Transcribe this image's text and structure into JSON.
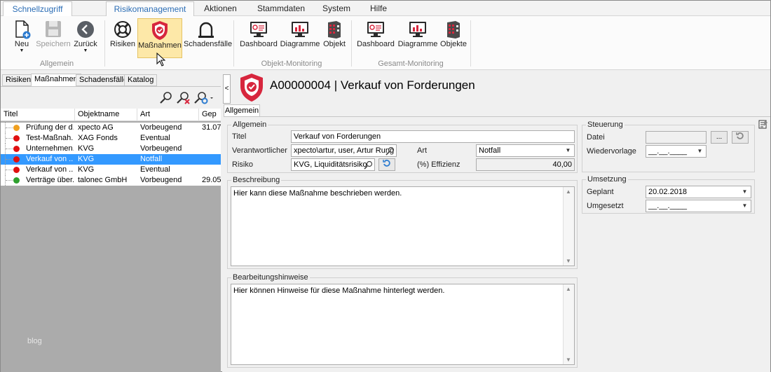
{
  "ribbon": {
    "tabs": [
      "Schnellzugriff",
      "Risikomanagement",
      "Aktionen",
      "Stammdaten",
      "System",
      "Hilfe"
    ],
    "active_tab": "Risikomanagement",
    "buttons": {
      "neu": "Neu",
      "speichern": "Speichern",
      "zurueck": "Zurück",
      "risiken": "Risiken",
      "massnahmen": "Maßnahmen",
      "schadensfaelle": "Schadensfälle",
      "dashboard1": "Dashboard",
      "diagramme1": "Diagramme",
      "objekt": "Objekt",
      "dashboard2": "Dashboard",
      "diagramme2": "Diagramme",
      "objekte": "Objekte"
    },
    "groups": {
      "allgemein": "Allgemein",
      "objekt_monitoring": "Objekt-Monitoring",
      "gesamt_monitoring": "Gesamt-Monitoring"
    },
    "accent": "#d7263d"
  },
  "left": {
    "tabs": [
      "Risiken",
      "Maßnahmen",
      "Schadensfälle",
      "Katalog"
    ],
    "active_tab": "Maßnahmen",
    "columns": [
      "Titel",
      "Objektname",
      "Art",
      "Gep"
    ],
    "rows": [
      {
        "titel": "Prüfung der d...",
        "objekt": "xpecto AG",
        "art": "Vorbeugend",
        "gep": "31.07",
        "status": "#f0a020",
        "selected": false
      },
      {
        "titel": "Test-Maßnah...",
        "objekt": "XAG Fonds",
        "art": "Eventual",
        "gep": "",
        "status": "#e01010",
        "selected": false
      },
      {
        "titel": "Unternehmen...",
        "objekt": "KVG",
        "art": "Vorbeugend",
        "gep": "",
        "status": "#e01010",
        "selected": false
      },
      {
        "titel": "Verkauf von ...",
        "objekt": "KVG",
        "art": "Notfall",
        "gep": "",
        "status": "#e01010",
        "selected": true
      },
      {
        "titel": "Verkauf von ...",
        "objekt": "KVG",
        "art": "Eventual",
        "gep": "",
        "status": "#e01010",
        "selected": false
      },
      {
        "titel": "Verträge über...",
        "objekt": "talonec GmbH",
        "art": "Vorbeugend",
        "gep": "29.05",
        "status": "#2ea02e",
        "selected": false
      }
    ],
    "watermark": "blog"
  },
  "detail": {
    "title": "A00000004 | Verkauf von Forderungen",
    "tab": "Allgemein",
    "allgemein": {
      "legend": "Allgemein",
      "titel_label": "Titel",
      "titel_value": "Verkauf von Forderungen",
      "verantwortlicher_label": "Verantwortlicher",
      "verantwortlicher_value": "xpecto\\artur, user, Artur Rung",
      "art_label": "Art",
      "art_value": "Notfall",
      "risiko_label": "Risiko",
      "risiko_value": "KVG, Liquiditätsrisiko",
      "effizienz_label": "(%) Effizienz",
      "effizienz_value": "40,00"
    },
    "beschreibung": {
      "legend": "Beschreibung",
      "text": "Hier kann diese Maßnahme beschrieben werden."
    },
    "hinweise": {
      "legend": "Bearbeitungshinweise",
      "text": "Hier können Hinweise für diese Maßnahme hinterlegt werden."
    },
    "steuerung": {
      "legend": "Steuerung",
      "datei_label": "Datei",
      "datei_value": "",
      "browse_label": "...",
      "wiedervorlage_label": "Wiedervorlage",
      "wiedervorlage_value": "__.__.____"
    },
    "umsetzung": {
      "legend": "Umsetzung",
      "geplant_label": "Geplant",
      "geplant_value": "20.02.2018",
      "umgesetzt_label": "Umgesetzt",
      "umgesetzt_value": "__.__.____"
    }
  }
}
